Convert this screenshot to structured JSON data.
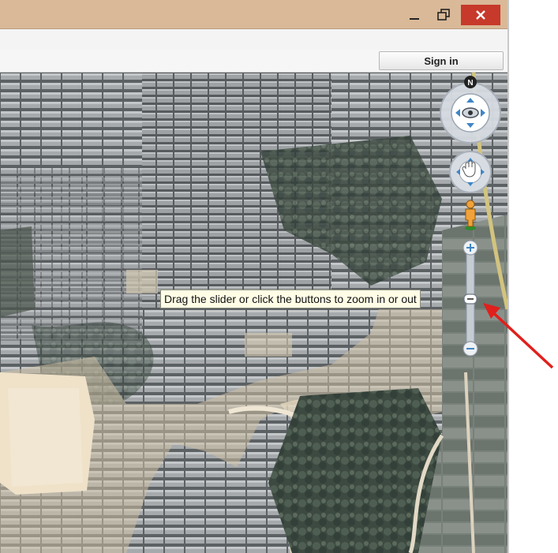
{
  "account": {
    "sign_in_label": "Sign in"
  },
  "map_controls": {
    "compass_north_label": "N",
    "zoom_tooltip": "Drag the slider or click the buttons to zoom in or out",
    "zoom_plus": "+",
    "zoom_minus": "−"
  },
  "colors": {
    "titlebar": "#d9b997",
    "close_button": "#c7392a",
    "annotation_arrow": "#e0201c",
    "tooltip_bg": "#fffde6"
  },
  "icons": [
    "minimize-icon",
    "maximize-icon",
    "close-icon",
    "compass-icon",
    "eye-icon",
    "hand-icon",
    "pegman-icon",
    "zoom-in-icon",
    "zoom-out-icon",
    "red-arrow-icon"
  ]
}
